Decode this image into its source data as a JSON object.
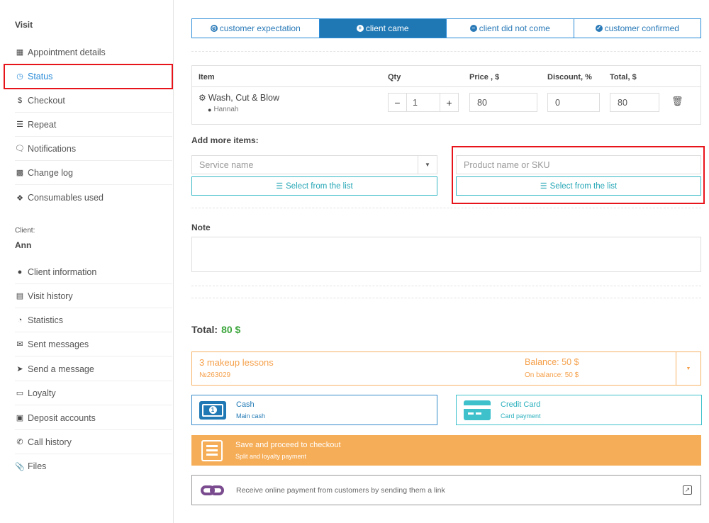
{
  "sidebar": {
    "visit_header": "Visit",
    "visit_items": [
      {
        "label": "Appointment details",
        "icon": "calendar-icon"
      },
      {
        "label": "Status",
        "icon": "clock-icon"
      },
      {
        "label": "Checkout",
        "icon": "dollar-icon"
      },
      {
        "label": "Repeat",
        "icon": "list-icon"
      },
      {
        "label": "Notifications",
        "icon": "comments-icon"
      },
      {
        "label": "Change log",
        "icon": "file-icon"
      },
      {
        "label": "Consumables used",
        "icon": "cubes-icon"
      }
    ],
    "client_caption": "Client:",
    "client_name": "Ann",
    "client_items": [
      {
        "label": "Client information",
        "icon": "user-icon"
      },
      {
        "label": "Visit history",
        "icon": "list-alt-icon"
      },
      {
        "label": "Statistics",
        "icon": "pie-chart-icon"
      },
      {
        "label": "Sent messages",
        "icon": "envelope-icon"
      },
      {
        "label": "Send a message",
        "icon": "paper-plane-icon"
      },
      {
        "label": "Loyalty",
        "icon": "credit-card-icon"
      },
      {
        "label": "Deposit accounts",
        "icon": "briefcase-icon"
      },
      {
        "label": "Call history",
        "icon": "phone-icon"
      },
      {
        "label": "Files",
        "icon": "paperclip-icon"
      }
    ]
  },
  "status_tabs": [
    {
      "label": "customer expectation",
      "icon": "clock-icon"
    },
    {
      "label": "client came",
      "icon": "plus-circle-icon",
      "active": true
    },
    {
      "label": "client did not come",
      "icon": "minus-circle-icon"
    },
    {
      "label": "customer confirmed",
      "icon": "check-circle-icon"
    }
  ],
  "items_table": {
    "headers": {
      "item": "Item",
      "qty": "Qty",
      "price": "Price , $",
      "discount": "Discount, %",
      "total": "Total, $"
    },
    "rows": [
      {
        "service": "Wash, Cut & Blow",
        "staff": "Hannah",
        "qty": "1",
        "price": "80",
        "discount": "0",
        "total": "80"
      }
    ],
    "minus": "−",
    "plus": "+"
  },
  "add_items": {
    "title": "Add more items:",
    "service_placeholder": "Service name",
    "product_placeholder": "Product name or SKU",
    "select_list_label": "Select from the list"
  },
  "note": {
    "title": "Note",
    "value": ""
  },
  "total": {
    "label": "Total:",
    "value": "80 $"
  },
  "package": {
    "name": "3 makeup lessons",
    "number": "№263029",
    "balance": "Balance: 50 $",
    "on_balance": "On balance: 50 $"
  },
  "payments": [
    {
      "title": "Cash",
      "subtitle": "Main cash",
      "icon": "cash-icon"
    },
    {
      "title": "Credit Card",
      "subtitle": "Card payment",
      "icon": "credit-card-icon"
    }
  ],
  "save_checkout": {
    "title": "Save and proceed to checkout",
    "subtitle": "Split and loyalty payment"
  },
  "online_link": {
    "text": "Receive online payment from customers by sending them a link"
  },
  "colors": {
    "accent": "#1f78b4",
    "teal": "#36b8c6",
    "orange": "#f6ad57",
    "green": "#3aa53a",
    "highlight": "#e8141b"
  }
}
